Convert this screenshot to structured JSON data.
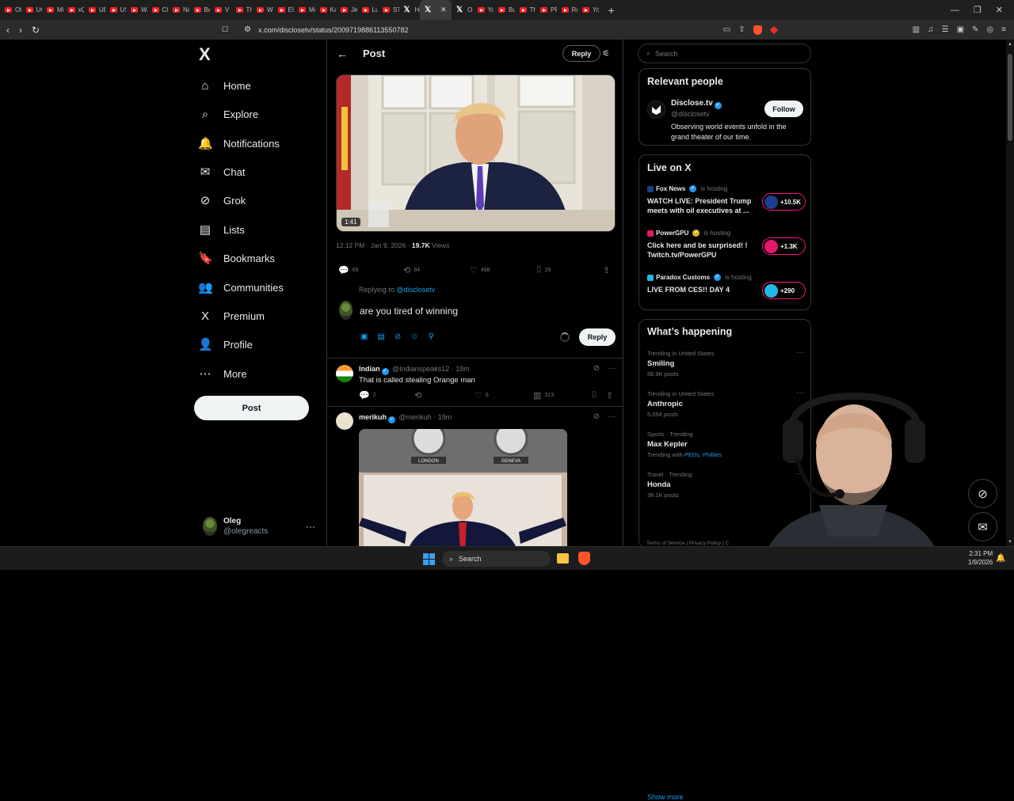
{
  "browser": {
    "tabs": [
      {
        "label": "Ott",
        "type": "yt"
      },
      {
        "label": "UC",
        "type": "yt"
      },
      {
        "label": "Mi",
        "type": "yt"
      },
      {
        "label": "xQ",
        "type": "yt"
      },
      {
        "label": "UE",
        "type": "yt"
      },
      {
        "label": "US",
        "type": "yt"
      },
      {
        "label": "Wa",
        "type": "yt"
      },
      {
        "label": "Clu",
        "type": "yt"
      },
      {
        "label": "Na",
        "type": "yt"
      },
      {
        "label": "Be",
        "type": "yt"
      },
      {
        "label": "V F",
        "type": "yt"
      },
      {
        "label": "Th",
        "type": "yt"
      },
      {
        "label": "WV",
        "type": "yt"
      },
      {
        "label": "EU",
        "type": "yt"
      },
      {
        "label": "Mc",
        "type": "yt"
      },
      {
        "label": "Kai",
        "type": "yt"
      },
      {
        "label": "Jer",
        "type": "yt"
      },
      {
        "label": "Lu",
        "type": "yt"
      },
      {
        "label": "ST/",
        "type": "yt"
      },
      {
        "label": "Ho",
        "type": "x"
      },
      {
        "label": "",
        "type": "x-active"
      },
      {
        "label": "OS",
        "type": "x"
      },
      {
        "label": "Yo",
        "type": "yt"
      },
      {
        "label": "Bu",
        "type": "yt"
      },
      {
        "label": "Th",
        "type": "yt"
      },
      {
        "label": "PP",
        "type": "yt"
      },
      {
        "label": "Ru",
        "type": "yt"
      },
      {
        "label": "Yo",
        "type": "yt"
      }
    ],
    "url": "x.com/disclosetv/status/2009719886113550782"
  },
  "left_nav": {
    "logo": "X",
    "items": [
      {
        "label": "Home",
        "icon": "home-icon",
        "glyph": "⌂"
      },
      {
        "label": "Explore",
        "icon": "search-icon",
        "glyph": "⌕"
      },
      {
        "label": "Notifications",
        "icon": "bell-icon",
        "glyph": "🔔"
      },
      {
        "label": "Chat",
        "icon": "mail-icon",
        "glyph": "✉"
      },
      {
        "label": "Grok",
        "icon": "grok-icon",
        "glyph": "⊘"
      },
      {
        "label": "Lists",
        "icon": "list-icon",
        "glyph": "▤"
      },
      {
        "label": "Bookmarks",
        "icon": "bookmark-icon",
        "glyph": "🔖"
      },
      {
        "label": "Communities",
        "icon": "communities-icon",
        "glyph": "👥"
      },
      {
        "label": "Premium",
        "icon": "x-premium-icon",
        "glyph": "X"
      },
      {
        "label": "Profile",
        "icon": "person-icon",
        "glyph": "👤"
      },
      {
        "label": "More",
        "icon": "more-circle-icon",
        "glyph": "⋯"
      }
    ],
    "post_button": "Post",
    "account": {
      "name": "Oleg",
      "handle": "@olegreacts"
    }
  },
  "post": {
    "header_title": "Post",
    "header_reply": "Reply",
    "video_duration": "1:41",
    "timestamp": "12:12 PM · Jan 9, 2026 · ",
    "views_count": "19.7K",
    "views_label": " Views",
    "actions": {
      "replies": "68",
      "reposts": "84",
      "likes": "498",
      "bookmarks": "29"
    },
    "replying_to_prefix": "Replying to ",
    "replying_to_handle": "@disclosetv",
    "composer_value": "are you tired of winning",
    "reply_button": "Reply"
  },
  "replies": [
    {
      "name": "Indian",
      "handle": "@Indianspeaks12",
      "time": "· 18m",
      "text": "That is called stealing Orange man",
      "replies": "2",
      "reposts": "",
      "likes": "6",
      "views": "313"
    },
    {
      "name": "merikuh",
      "handle": "@merikuh",
      "time": "· 19m",
      "image_labels": [
        "LONDON",
        "GENEVA"
      ]
    }
  ],
  "right": {
    "search_placeholder": "Search",
    "relevant": {
      "title": "Relevant people",
      "name": "Disclose.tv",
      "handle": "@disclosetv",
      "bio": "Observing world events unfold in the grand theater of our time.",
      "follow": "Follow"
    },
    "live": {
      "title": "Live on X",
      "items": [
        {
          "host": "Fox News",
          "status": "is hosting",
          "desc": "WATCH LIVE: President Trump meets with oil executives at ...",
          "count": "+10.5K",
          "color": "#1d3e8a",
          "badge": "blue"
        },
        {
          "host": "PowerGPU",
          "status": "is hosting",
          "desc": "Click here and be surprised! ! Twitch.tv/PowerGPU",
          "count": "+1.3K",
          "color": "#e4186a",
          "badge": "gold"
        },
        {
          "host": "Paradox Customs",
          "status": "is hosting",
          "desc": "LIVE FROM CES!! DAY 4",
          "count": "+290",
          "color": "#26b6e8",
          "badge": "blue"
        }
      ]
    },
    "happening": {
      "title": "What’s happening",
      "trends": [
        {
          "category": "Trending in United States",
          "name": "Smiling",
          "count": "56.9K posts"
        },
        {
          "category": "Trending in United States",
          "name": "Anthropic",
          "count": "5,054 posts"
        },
        {
          "category": "Sports · Trending",
          "name": "Max Kepler",
          "count_prefix": "Trending with ",
          "count_links": "PEDs, Phillies"
        },
        {
          "category": "Travel · Trending",
          "name": "Honda",
          "count": "38.1K posts"
        }
      ],
      "show_more": "Show more"
    },
    "footer": "Terms of Service  |  Privacy Policy  |  C"
  },
  "taskbar": {
    "search": "Search",
    "time": "2:31 PM",
    "date": "1/9/2026"
  }
}
